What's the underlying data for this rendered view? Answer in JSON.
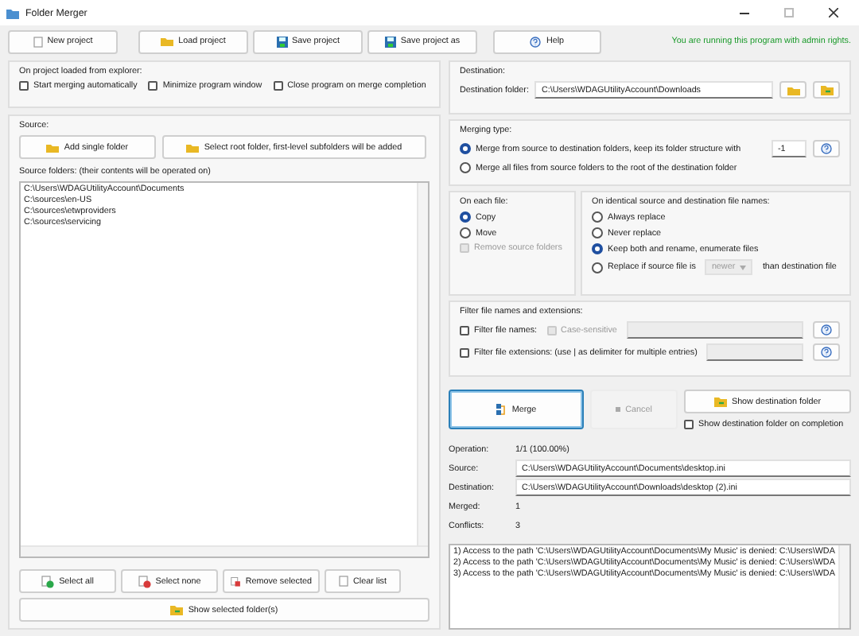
{
  "window": {
    "title": "Folder Merger"
  },
  "toolbar": [
    {
      "label": "New project"
    },
    {
      "label": "Load project"
    },
    {
      "label": "Save project"
    },
    {
      "label": "Save project as"
    },
    {
      "label": "Help"
    }
  ],
  "admin_notice": "You are running this program with admin rights.",
  "explorer_options": {
    "title": "On project loaded from explorer:",
    "options": [
      {
        "label": "Start merging automatically",
        "checked": false
      },
      {
        "label": "Minimize program window",
        "checked": false
      },
      {
        "label": "Close program on merge completion",
        "checked": false
      }
    ]
  },
  "source": {
    "title": "Source:",
    "buttons": [
      {
        "label": "Add single folder"
      },
      {
        "label": "Select root folder, first-level subfolders will be added"
      }
    ],
    "list_label": "Source folders: (their contents will be operated on)",
    "folders": [
      "C:\\Users\\WDAGUtilityAccount\\Documents",
      "C:\\sources\\en-US",
      "C:\\sources\\etwproviders",
      "C:\\sources\\servicing"
    ],
    "list_buttons": [
      {
        "label": "Select all"
      },
      {
        "label": "Select none"
      },
      {
        "label": "Remove selected"
      },
      {
        "label": "Clear list"
      }
    ],
    "show_button": {
      "label": "Show selected folder(s)"
    }
  },
  "destination": {
    "title": "Destination:",
    "label": "Destination folder:",
    "value": "C:\\Users\\WDAGUtilityAccount\\Downloads"
  },
  "merging_type": {
    "title": "Merging type:",
    "options": [
      {
        "label": "Merge from source to destination folders, keep its folder structure with",
        "selected": true
      },
      {
        "label": "Merge all files from source folders to the root of the destination folder",
        "selected": false
      }
    ],
    "depth": "-1"
  },
  "on_each_file": {
    "title": "On each file:",
    "options": [
      {
        "label": "Copy",
        "selected": true
      },
      {
        "label": "Move",
        "selected": false
      }
    ],
    "remove_source": {
      "label": "Remove source folders",
      "checked": false,
      "disabled": true
    }
  },
  "on_identical": {
    "title": "On identical source and destination file names:",
    "options": [
      {
        "label": "Always replace",
        "selected": false
      },
      {
        "label": "Never replace",
        "selected": false
      },
      {
        "label": "Keep both and rename, enumerate files",
        "selected": true
      },
      {
        "label": "Replace if source file is",
        "selected": false,
        "select": "newer",
        "suffix": "than destination file"
      }
    ]
  },
  "filter": {
    "title": "Filter file names and extensions:",
    "names": {
      "label": "Filter file names:",
      "checked": false
    },
    "case_sensitive": {
      "label": "Case-sensitive",
      "checked": false,
      "disabled": true
    },
    "extensions": {
      "label": "Filter file extensions: (use | as delimiter for multiple entries)",
      "checked": false
    }
  },
  "actions": {
    "merge": "Merge",
    "cancel": {
      "label": "Cancel",
      "disabled": true
    },
    "show_destination": "Show destination folder",
    "show_on_completion": {
      "label": "Show destination folder on completion",
      "checked": false
    }
  },
  "stats": [
    {
      "label": "Operation:",
      "value": "1/1 (100.00%)",
      "kind": "text"
    },
    {
      "label": "Source:",
      "value": "C:\\Users\\WDAGUtilityAccount\\Documents\\desktop.ini",
      "kind": "field"
    },
    {
      "label": "Destination:",
      "value": "C:\\Users\\WDAGUtilityAccount\\Downloads\\desktop (2).ini",
      "kind": "field"
    },
    {
      "label": "Merged:",
      "value": "1",
      "kind": "text"
    },
    {
      "label": "Conflicts:",
      "value": "3",
      "kind": "text"
    }
  ],
  "log": [
    "1) Access to the path 'C:\\Users\\WDAGUtilityAccount\\Documents\\My Music' is denied: C:\\Users\\WDA",
    "2) Access to the path 'C:\\Users\\WDAGUtilityAccount\\Documents\\My Music' is denied: C:\\Users\\WDA",
    "3) Access to the path 'C:\\Users\\WDAGUtilityAccount\\Documents\\My Music' is denied: C:\\Users\\WDA"
  ]
}
